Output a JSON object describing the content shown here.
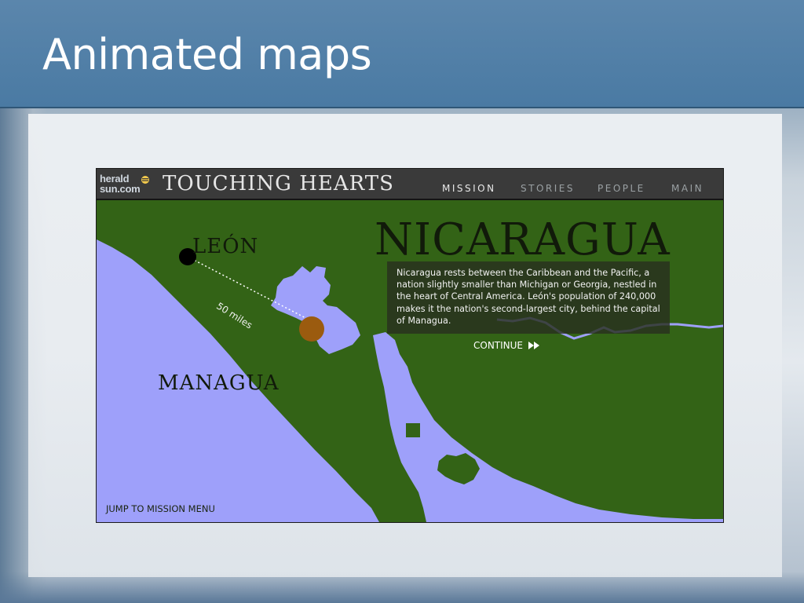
{
  "slide": {
    "title": "Animated maps"
  },
  "app": {
    "logo_line1": "herald",
    "logo_line2": "sun.com",
    "title": "TOUCHING HEARTS",
    "nav": [
      {
        "label": "MISSION",
        "active": true
      },
      {
        "label": "STORIES",
        "active": false
      },
      {
        "label": "PEOPLE",
        "active": false
      },
      {
        "label": "MAIN",
        "active": false
      }
    ],
    "country": "NICARAGUA",
    "info_text": "Nicaragua rests between the Caribbean and the Pacific, a nation slightly smaller than Michigan or Georgia, nestled in the heart of Central America. León's population of 240,000 makes it the nation's second-largest city, behind the capital of Managua.",
    "continue_label": "CONTINUE",
    "jump_label": "JUMP TO MISSION MENU",
    "map": {
      "cities": [
        "LEÓN",
        "MANAGUA"
      ],
      "distance_label": "50 miles"
    },
    "colors": {
      "land": "#336316",
      "water": "#9ea0fa",
      "leon_dot": "#000000",
      "managua_dot": "#9b5b0f"
    }
  }
}
